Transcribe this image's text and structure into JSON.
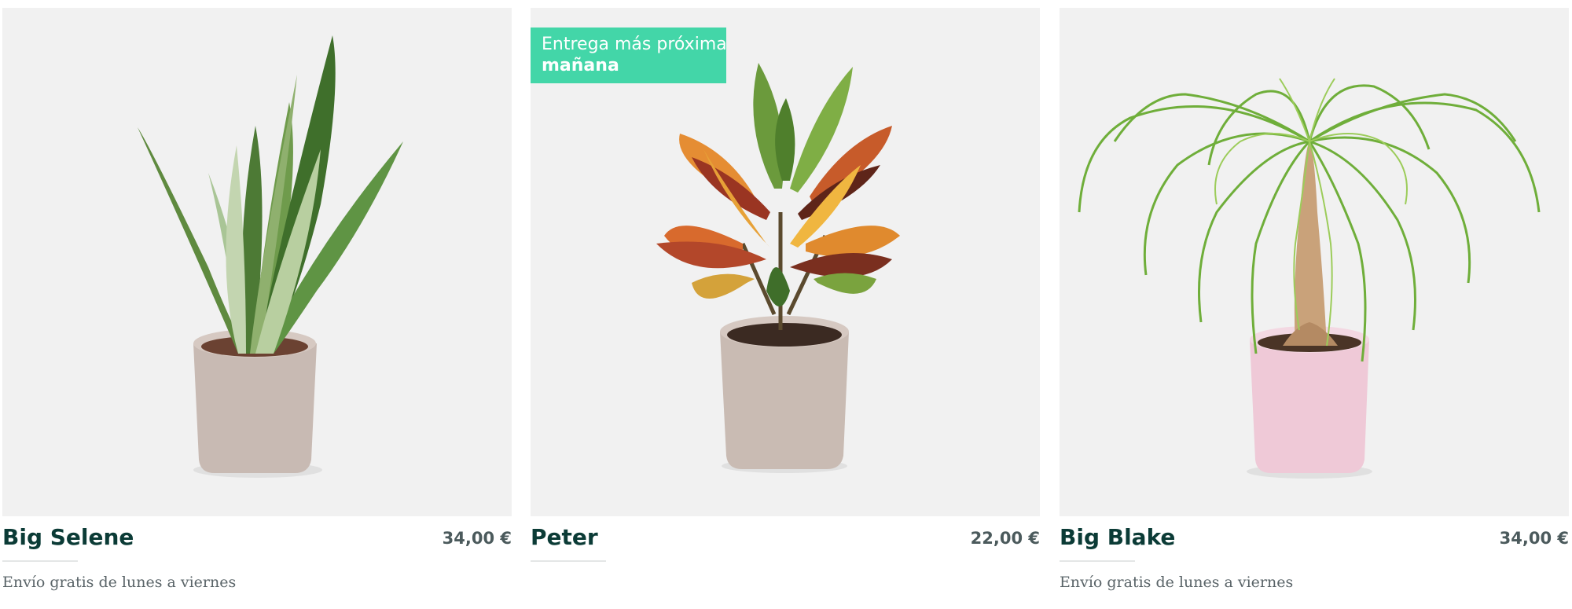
{
  "products": [
    {
      "name": "Big Selene",
      "price": "34,00 €",
      "shipping": "Envío gratis de lunes a viernes",
      "image_alt": "snake-plant-photo"
    },
    {
      "name": "Peter",
      "price": "22,00 €",
      "shipping": "",
      "badge": {
        "line1": "Entrega más próxima",
        "line2": "mañana"
      },
      "image_alt": "croton-plant-photo"
    },
    {
      "name": "Big Blake",
      "price": "34,00 €",
      "shipping": "Envío gratis de lunes a viernes",
      "image_alt": "ponytail-palm-photo"
    }
  ],
  "colors": {
    "badge": "#43d6a8",
    "title": "#0b3b36",
    "price": "#4b5a5c",
    "photo_bg": "#f1f1f1"
  }
}
